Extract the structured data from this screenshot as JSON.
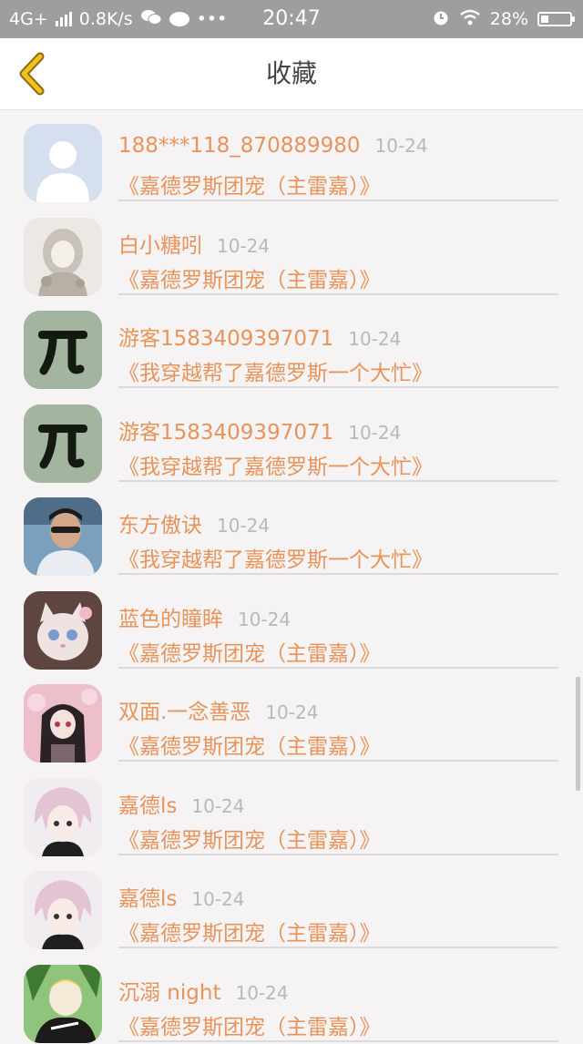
{
  "status_bar": {
    "network": "4G+",
    "speed": "0.8K/s",
    "dots": "•••",
    "time": "20:47",
    "battery": "28%",
    "battery_level": 0.28
  },
  "header": {
    "title": "收藏"
  },
  "items": [
    {
      "avatar": "default-avatar",
      "name": "188***118_870889980",
      "date": "10-24",
      "book": "《嘉德罗斯团宠（主雷嘉）》"
    },
    {
      "avatar": "girl-sketch-avatar",
      "name": "白小糖吲",
      "date": "10-24",
      "book": "《嘉德罗斯团宠（主雷嘉）》"
    },
    {
      "avatar": "pi-avatar",
      "name": "游客1583409397071",
      "date": "10-24",
      "book": "《我穿越帮了嘉德罗斯一个大忙》"
    },
    {
      "avatar": "pi-avatar",
      "name": "游客1583409397071",
      "date": "10-24",
      "book": "《我穿越帮了嘉德罗斯一个大忙》"
    },
    {
      "avatar": "photo-avatar",
      "name": "东方傲诀",
      "date": "10-24",
      "book": "《我穿越帮了嘉德罗斯一个大忙》"
    },
    {
      "avatar": "cat-avatar",
      "name": "蓝色的瞳眸",
      "date": "10-24",
      "book": "《嘉德罗斯团宠（主雷嘉）》"
    },
    {
      "avatar": "anime-girl-avatar",
      "name": "双面.一念善恶",
      "date": "10-24",
      "book": "《嘉德罗斯团宠（主雷嘉）》"
    },
    {
      "avatar": "anime-boy-avatar",
      "name": "嘉德ls",
      "date": "10-24",
      "book": "《嘉德罗斯团宠（主雷嘉）》"
    },
    {
      "avatar": "anime-boy-avatar",
      "name": "嘉德ls",
      "date": "10-24",
      "book": "《嘉德罗斯团宠（主雷嘉）》"
    },
    {
      "avatar": "night-avatar",
      "name": "沉溺 night",
      "date": "10-24",
      "book": "《嘉德罗斯团宠（主雷嘉）》"
    }
  ],
  "colors": {
    "accent": "#e8935a",
    "date": "#b9b9b9",
    "status_bar": "#9e9e9e",
    "back_arrow": "#f3c21a"
  }
}
